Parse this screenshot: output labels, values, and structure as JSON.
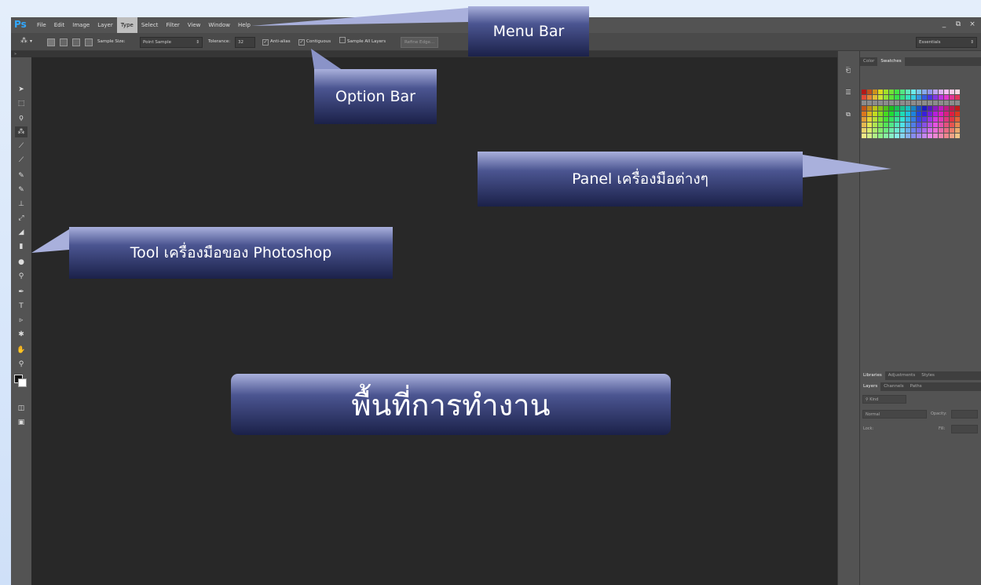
{
  "app": {
    "logo": "Ps",
    "menus": [
      "File",
      "Edit",
      "Image",
      "Layer",
      "Type",
      "Select",
      "Filter",
      "View",
      "Window",
      "Help"
    ],
    "active_menu_index": 4,
    "window_controls": {
      "minimize": "_",
      "restore": "⧉",
      "close": "×"
    }
  },
  "options_bar": {
    "sample_size_label": "Sample Size:",
    "sample_size_value": "Point Sample",
    "tolerance_label": "Tolerance:",
    "tolerance_value": "32",
    "anti_alias": "Anti-alias",
    "contiguous": "Contiguous",
    "sample_all_layers": "Sample All Layers",
    "refine_edge": "Refine Edge...",
    "workspace": "Essentials"
  },
  "panels": {
    "top_tabs": [
      "Color",
      "Swatches"
    ],
    "bottom_tabs": [
      "Libraries",
      "Adjustments",
      "Styles"
    ],
    "layers_tabs": [
      "Layers",
      "Channels",
      "Paths"
    ],
    "kind_label": "Kind",
    "blend_mode": "Normal",
    "opacity_label": "Opacity:",
    "lock_label": "Lock:",
    "fill_label": "Fill:"
  },
  "callouts": {
    "menu_bar": "Menu Bar",
    "option_bar": "Option Bar",
    "panel": "Panel เครื่องมือต่างๆ",
    "tool": "Tool เครื่องมือของ Photoshop",
    "workspace": "พื้นที่การทำงาน"
  },
  "colors": {
    "callout_top": "#a9b0dc",
    "callout_bottom": "#1b2149",
    "ps_blue": "#31a8ff",
    "workspace_bg": "#282828"
  }
}
